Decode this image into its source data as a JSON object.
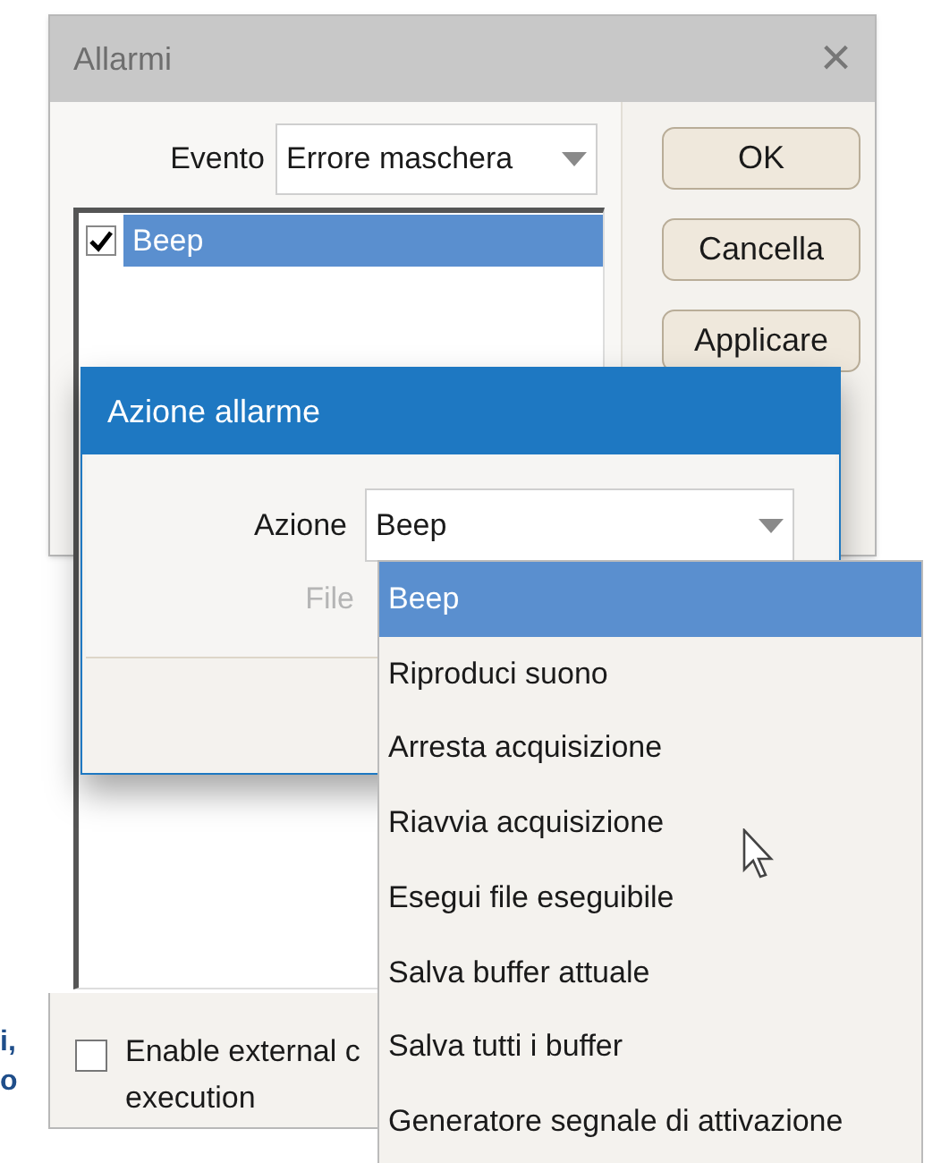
{
  "margin_text": [
    "i,",
    "o"
  ],
  "window": {
    "title": "Allarmi",
    "close": "×"
  },
  "event": {
    "label": "Evento",
    "value": "Errore maschera"
  },
  "alarms": [
    {
      "label": "Beep",
      "checked": true,
      "selected": true
    }
  ],
  "buttons": [
    "OK",
    "Cancella",
    "Applicare"
  ],
  "external": {
    "lines": [
      "Enable external c",
      "execution"
    ],
    "checked": false
  },
  "action_dialog": {
    "title": "Azione allarme",
    "action_label": "Azione",
    "action_value": "Beep",
    "file_label": "File",
    "file_disabled": true
  },
  "dropdown": [
    {
      "label": "Beep",
      "selected": true
    },
    {
      "label": "Riproduci suono",
      "selected": false
    },
    {
      "label": "Arresta acquisizione",
      "selected": false
    },
    {
      "label": "Riavvia acquisizione",
      "selected": false
    },
    {
      "label": "Esegui file eseguibile",
      "selected": false
    },
    {
      "label": "Salva buffer attuale",
      "selected": false
    },
    {
      "label": "Salva tutti i buffer",
      "selected": false
    },
    {
      "label": "Generatore segnale di attivazione",
      "selected": false
    }
  ]
}
